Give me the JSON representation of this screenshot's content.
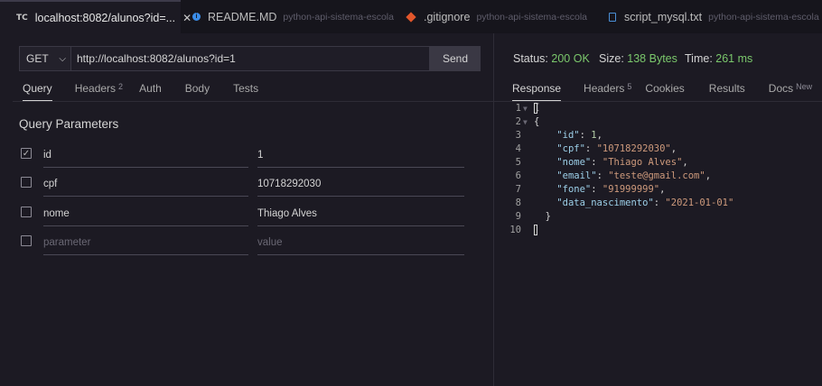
{
  "tabs": [
    {
      "icon": "TC",
      "title": "localhost:8082/alunos?id=...",
      "close": "✕"
    },
    {
      "title": "README.MD",
      "path": "python-api-sistema-escola"
    },
    {
      "title": ".gitignore",
      "path": "python-api-sistema-escola"
    },
    {
      "title": "script_mysql.txt",
      "path": "python-api-sistema-escola"
    }
  ],
  "request": {
    "method": "GET",
    "url": "http://localhost:8082/alunos?id=1",
    "send_label": "Send",
    "tabs": [
      {
        "label": "Query"
      },
      {
        "label": "Headers",
        "count": "2"
      },
      {
        "label": "Auth"
      },
      {
        "label": "Body"
      },
      {
        "label": "Tests"
      }
    ],
    "section_title": "Query Parameters",
    "params": [
      {
        "checked": true,
        "key": "id",
        "value": "1"
      },
      {
        "checked": false,
        "key": "cpf",
        "value": "10718292030"
      },
      {
        "checked": false,
        "key": "nome",
        "value": "Thiago Alves"
      }
    ],
    "placeholder": {
      "key": "parameter",
      "value": "value"
    }
  },
  "response": {
    "status_label": "Status:",
    "status_value": "200 OK",
    "size_label": "Size:",
    "size_value": "138 Bytes",
    "time_label": "Time:",
    "time_value": "261 ms",
    "tabs": [
      {
        "label": "Response"
      },
      {
        "label": "Headers",
        "count": "5"
      },
      {
        "label": "Cookies"
      },
      {
        "label": "Results"
      },
      {
        "label": "Docs",
        "badge": "New"
      }
    ],
    "line_numbers": [
      "1",
      "2",
      "3",
      "4",
      "5",
      "6",
      "7",
      "8",
      "9",
      "10"
    ],
    "body": {
      "line1": "[",
      "line2": "{",
      "k_id": "\"id\"",
      "v_id": "1",
      "k_cpf": "\"cpf\"",
      "v_cpf": "\"10718292030\"",
      "k_nome": "\"nome\"",
      "v_nome": "\"Thiago Alves\"",
      "k_email": "\"email\"",
      "v_email": "\"teste@gmail.com\"",
      "k_fone": "\"fone\"",
      "v_fone": "\"91999999\"",
      "k_dn": "\"data_nascimento\"",
      "v_dn": "\"2021-01-01\"",
      "line9": "}"
    }
  }
}
